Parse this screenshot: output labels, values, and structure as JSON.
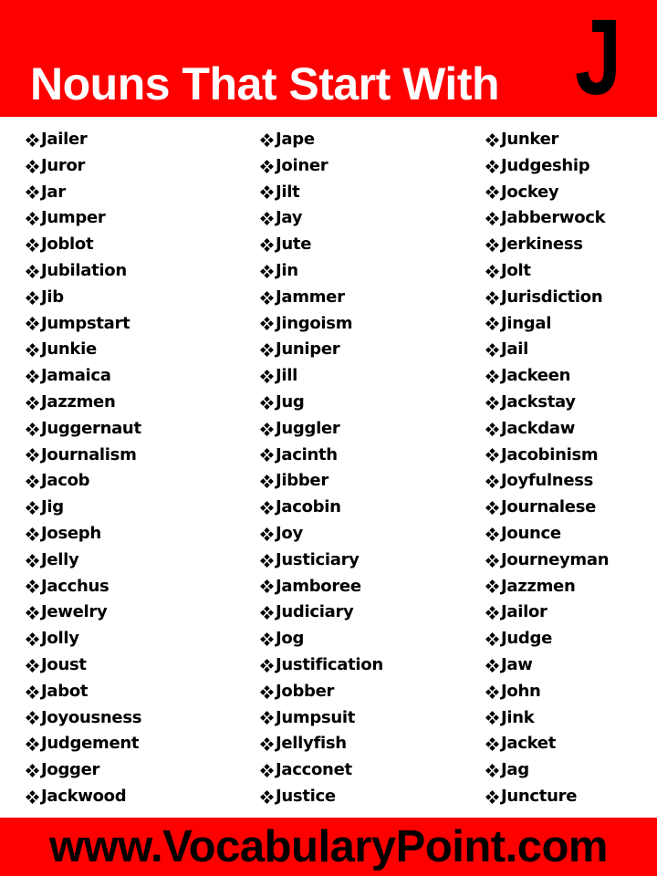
{
  "header": {
    "title": "Nouns That Start With",
    "letter": "J",
    "background_color": "#ff0000",
    "title_color": "#ffffff",
    "letter_color": "#000000"
  },
  "bullet_icon": "four-diamond-bullet-icon",
  "columns": [
    {
      "items": [
        "Jailer",
        "Juror",
        "Jar",
        "Jumper",
        "Joblot",
        "Jubilation",
        "Jib",
        "Jumpstart",
        "Junkie",
        "Jamaica",
        "Jazzmen",
        "Juggernaut",
        "Journalism",
        "Jacob",
        "Jig",
        "Joseph",
        "Jelly",
        "Jacchus",
        "Jewelry",
        "Jolly",
        "Joust",
        "Jabot",
        "Joyousness",
        "Judgement",
        "Jogger",
        "Jackwood"
      ]
    },
    {
      "items": [
        "Jape",
        "Joiner",
        "Jilt",
        "Jay",
        "Jute",
        "Jin",
        "Jammer",
        "Jingoism",
        "Juniper",
        "Jill",
        "Jug",
        "Juggler",
        "Jacinth",
        "Jibber",
        "Jacobin",
        "Joy",
        "Justiciary",
        "Jamboree",
        "Judiciary",
        "Jog",
        "Justification",
        "Jobber",
        "Jumpsuit",
        "Jellyfish",
        "Jacconet",
        "Justice"
      ]
    },
    {
      "items": [
        "Junker",
        "Judgeship",
        "Jockey",
        "Jabberwock",
        "Jerkiness",
        "Jolt",
        "Jurisdiction",
        "Jingal",
        "Jail",
        "Jackeen",
        "Jackstay",
        "Jackdaw",
        "Jacobinism",
        "Joyfulness",
        "Journalese",
        "Jounce",
        "Journeyman",
        "Jazzmen",
        "Jailor",
        "Judge",
        "Jaw",
        "John",
        "Jink",
        "Jacket",
        "Jag",
        "Juncture"
      ]
    }
  ],
  "footer": {
    "website": "www.VocabularyPoint.com",
    "background_color": "#ff0000",
    "text_color": "#000000"
  }
}
